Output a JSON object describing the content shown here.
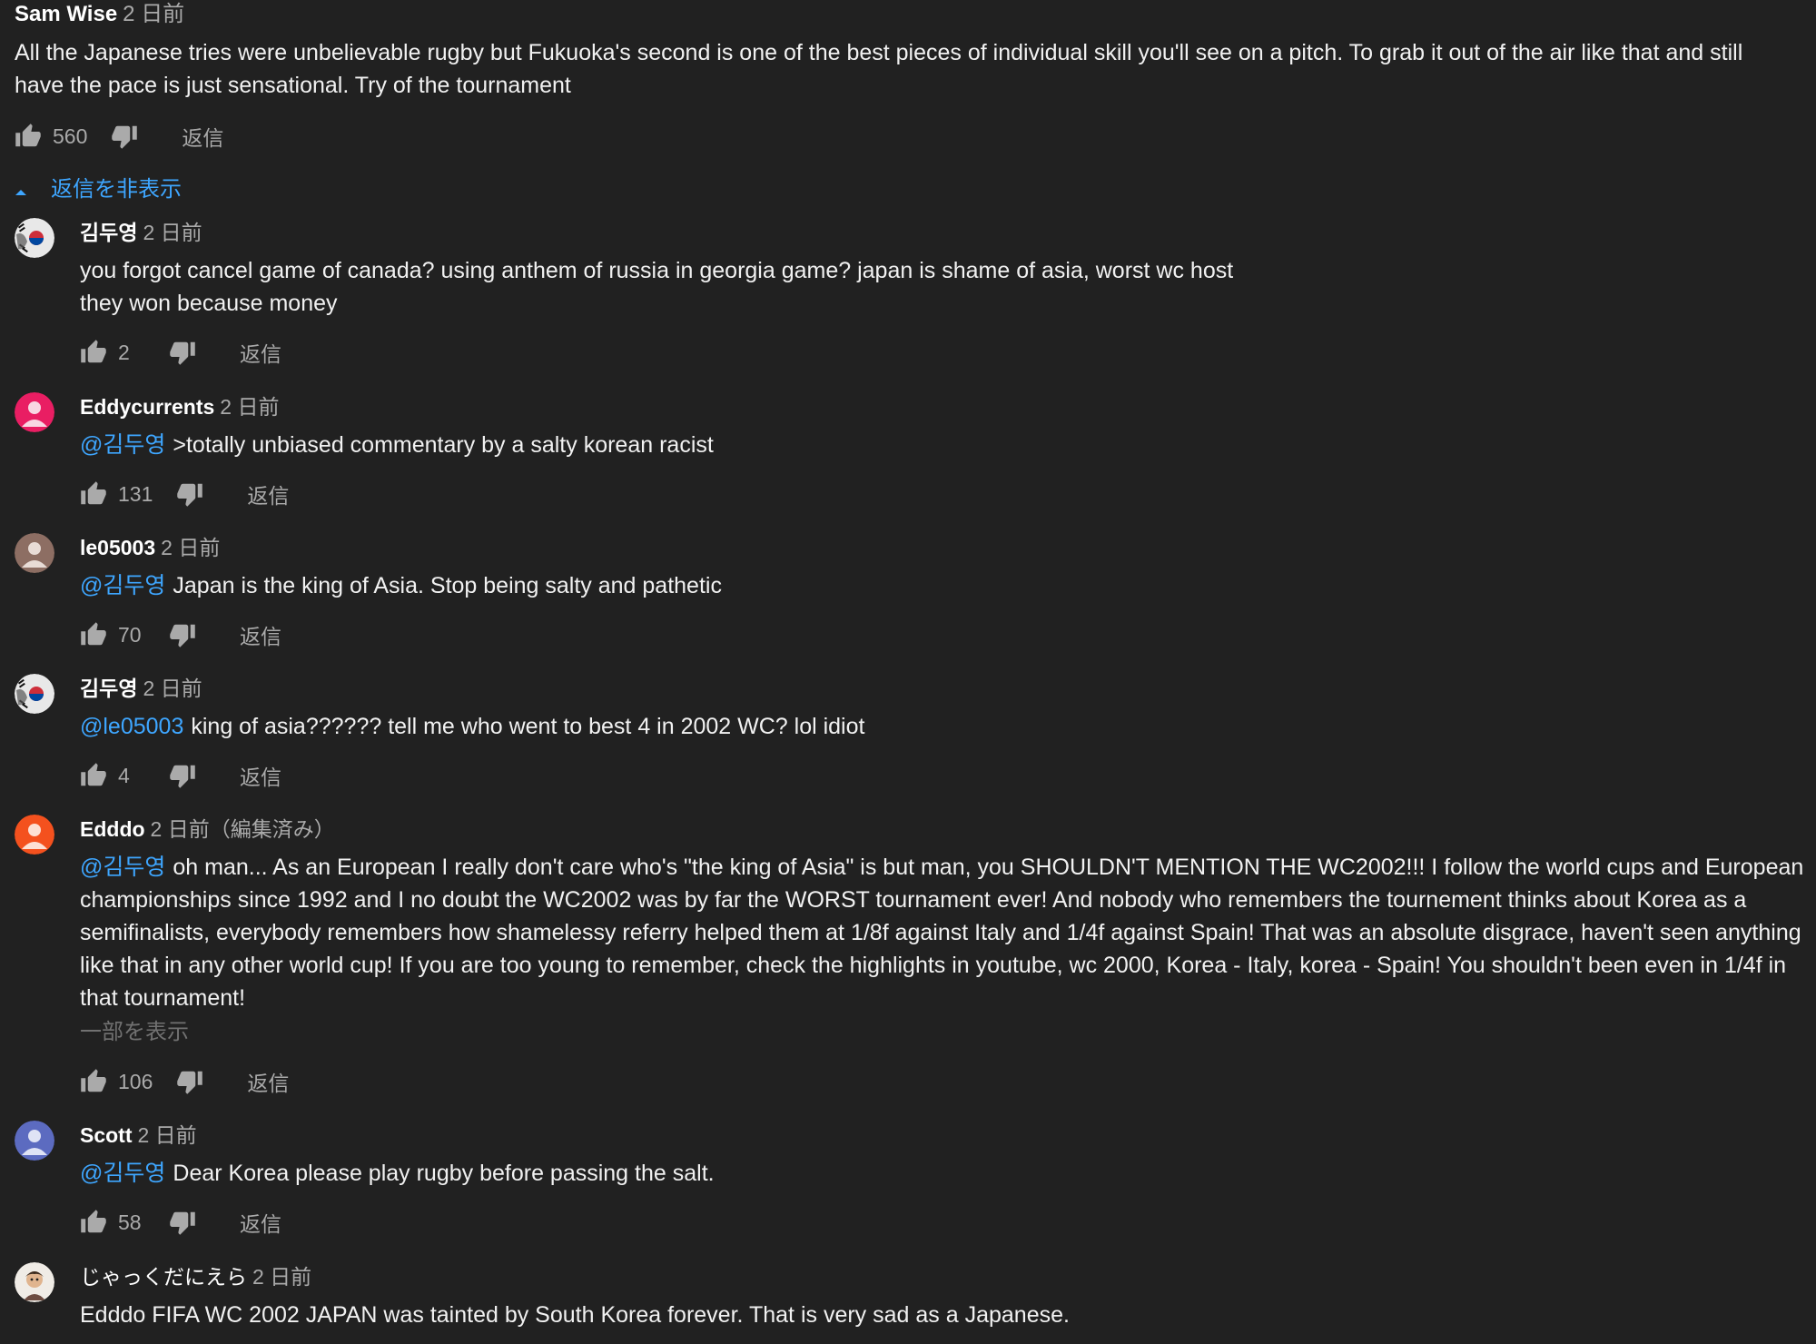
{
  "colors": {
    "background": "#212121",
    "text": "#f1f1f1",
    "secondary": "#aaaaaa",
    "link": "#3ea6ff"
  },
  "top_comment": {
    "author": "Sam Wise",
    "time": "2 日前",
    "text": "All the Japanese tries were unbelievable rugby but Fukuoka's second is one of the best pieces of individual skill you'll see on a pitch. To grab it out of the air like that and still have the pace is just sensational. Try of the tournament",
    "likes": "560",
    "reply_label": "返信"
  },
  "hide_replies_label": "返信を非表示",
  "replies": [
    {
      "author": "김두영",
      "time": "2 日前",
      "mention": "",
      "text_line1": "you forgot cancel game of canada? using anthem of russia in georgia game? japan is shame of asia, worst wc host",
      "text_line2": "they won because money",
      "likes": "2",
      "reply_label": "返信",
      "avatar_icon": "korean-flag-avatar-icon"
    },
    {
      "author": "Eddycurrents",
      "time": "2 日前",
      "mention": "@김두영",
      "text": ">totally unbiased commentary by a salty korean racist",
      "likes": "131",
      "reply_label": "返信",
      "avatar_icon": "default-user-avatar-icon",
      "avatar_color": "#e91e63"
    },
    {
      "author": "le05003",
      "time": "2 日前",
      "mention": "@김두영",
      "text": "Japan is the king of Asia. Stop being salty and pathetic",
      "likes": "70",
      "reply_label": "返信",
      "avatar_icon": "default-user-avatar-icon",
      "avatar_color": "#8d6e63"
    },
    {
      "author": "김두영",
      "time": "2 日前",
      "mention": "@le05003",
      "text": "king of asia?????? tell me who went to best 4 in 2002 WC? lol idiot",
      "likes": "4",
      "reply_label": "返信",
      "avatar_icon": "korean-flag-avatar-icon"
    },
    {
      "author": "Edddo",
      "time": "2 日前",
      "edited": "（編集済み）",
      "mention": "@김두영",
      "text": "oh man... As an European I really don't care who's \"the king of Asia\" is but man, you SHOULDN'T MENTION THE WC2002!!! I follow the world cups and European championships since 1992 and I no doubt the WC2002 was by far the WORST tournament ever! And nobody who remembers the tournement thinks about Korea as a semifinalists, everybody remembers how shamelessy referry helped them at 1/8f against Italy and 1/4f against Spain!  That was an absolute disgrace, haven't seen anything like that in any other world cup!  If you are too young to remember, check the highlights in youtube, wc 2000, Korea - Italy, korea - Spain! You shouldn't been even in 1/4f in that tournament!",
      "show_less": "一部を表示",
      "likes": "106",
      "reply_label": "返信",
      "avatar_icon": "default-user-avatar-icon",
      "avatar_color": "#f4511e"
    },
    {
      "author": "Scott",
      "time": "2 日前",
      "mention": "@김두영",
      "text": "Dear Korea please play rugby before passing the salt.",
      "likes": "58",
      "reply_label": "返信",
      "avatar_icon": "default-user-avatar-icon",
      "avatar_color": "#5c6bc0"
    },
    {
      "author": "じゃっくだにえら",
      "time": "2 日前",
      "mention": "",
      "text": "Edddo FIFA WC 2002 JAPAN was tainted by South Korea forever. That is very sad as a Japanese.",
      "avatar_icon": "photo-avatar-icon"
    }
  ]
}
